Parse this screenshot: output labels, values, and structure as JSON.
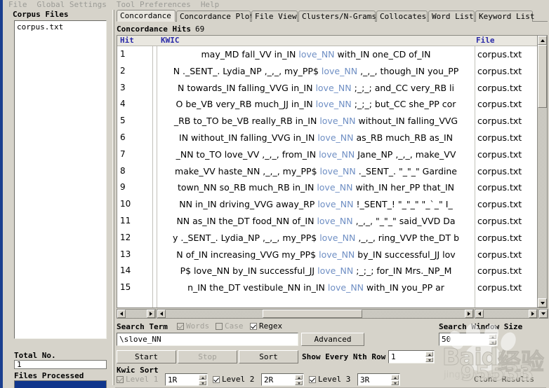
{
  "menu": {
    "items": [
      {
        "label": "File"
      },
      {
        "label": "Global Settings"
      },
      {
        "label": "Tool Preferences"
      },
      {
        "label": "Help"
      }
    ]
  },
  "sidebar": {
    "title": "Corpus Files",
    "files": [
      "corpus.txt"
    ],
    "total_label": "Total No.",
    "total_value": "1",
    "files_processed_label": "Files Processed"
  },
  "tabs": [
    {
      "label": "Concordance",
      "active": true
    },
    {
      "label": "Concordance Plot",
      "active": false
    },
    {
      "label": "File View",
      "active": false
    },
    {
      "label": "Clusters/N-Grams",
      "active": false
    },
    {
      "label": "Collocates",
      "active": false
    },
    {
      "label": "Word List",
      "active": false
    },
    {
      "label": "Keyword List",
      "active": false
    }
  ],
  "results": {
    "hits_label": "Concordance Hits",
    "hits_count": "69",
    "columns": {
      "hit": "Hit",
      "kwic": "KWIC",
      "file": "File"
    },
    "keyword": "love_NN",
    "rows": [
      {
        "n": "1",
        "left": "may_MD fall_VV in_IN",
        "right": "with_IN one_CD of_IN",
        "file": "corpus.txt"
      },
      {
        "n": "2",
        "left": "N ._SENT_. Lydia_NP ,_,_, my_PP$",
        "right": ",_,_, though_IN you_PP",
        "file": "corpus.txt"
      },
      {
        "n": "3",
        "left": "N towards_IN falling_VVG in_IN",
        "right": ";_;_; and_CC very_RB li",
        "file": "corpus.txt"
      },
      {
        "n": "4",
        "left": "O be_VB very_RB much_JJ in_IN",
        "right": ";_;_; but_CC she_PP cor",
        "file": "corpus.txt"
      },
      {
        "n": "5",
        "left": "_RB to_TO be_VB really_RB in_IN",
        "right": "without_IN falling_VVG",
        "file": "corpus.txt"
      },
      {
        "n": "6",
        "left": "IN without_IN falling_VVG in_IN",
        "right": "as_RB much_RB as_IN",
        "file": "corpus.txt"
      },
      {
        "n": "7",
        "left": "_NN to_TO love_VV ,_,_, from_IN",
        "right": "Jane_NP ,_,_, make_VV",
        "file": "corpus.txt"
      },
      {
        "n": "8",
        "left": "make_VV haste_NN ,_,_, my_PP$",
        "right": "._SENT_. \"_\"_\" Gardine",
        "file": "corpus.txt"
      },
      {
        "n": "9",
        "left": "town_NN so_RB much_RB in_IN",
        "right": "with_IN her_PP that_IN",
        "file": "corpus.txt"
      },
      {
        "n": "10",
        "left": "NN in_IN driving_VVG away_RP",
        "right": "!_SENT_! \"_\"_\" \"_`_\" I_",
        "file": "corpus.txt"
      },
      {
        "n": "11",
        "left": "NN as_IN the_DT food_NN of_IN",
        "right": ",_,_, \"_\"_\" said_VVD Da",
        "file": "corpus.txt"
      },
      {
        "n": "12",
        "left": "y ._SENT_. Lydia_NP ,_,_, my_PP$",
        "right": ",_,_, ring_VVP the_DT b",
        "file": "corpus.txt"
      },
      {
        "n": "13",
        "left": "N of_IN increasing_VVG my_PP$",
        "right": "by_IN successful_JJ lov",
        "file": "corpus.txt"
      },
      {
        "n": "14",
        "left": "P$ love_NN by_IN successful_JJ",
        "right": ";_;_; for_IN Mrs._NP_M",
        "file": "corpus.txt"
      },
      {
        "n": "15",
        "left": "n_IN the_DT vestibule_NN in_IN",
        "right": "with_IN you_PP      ar",
        "file": "corpus.txt"
      }
    ]
  },
  "controls": {
    "search_term_label": "Search Term",
    "checkbox_words": "Words",
    "checkbox_case": "Case",
    "checkbox_regex": "Regex",
    "words_checked": true,
    "words_disabled": true,
    "case_checked": false,
    "regex_checked": true,
    "search_value": "\\slove_NN",
    "search_placeholder": "",
    "advanced_label": "Advanced",
    "search_window_label": "Search Window Size",
    "search_window_value": "50",
    "start_label": "Start",
    "stop_label": "Stop",
    "sort_label": "Sort",
    "nth_row_label": "Show Every Nth Row",
    "nth_row_value": "1",
    "kwic_sort_label": "Kwic Sort",
    "level1_label": "Level 1",
    "level1_value": "1R",
    "level1_checked": true,
    "level1_disabled": true,
    "level2_label": "Level 2",
    "level2_value": "2R",
    "level2_checked": true,
    "level3_label": "Level 3",
    "level3_value": "3R",
    "level3_checked": true,
    "clone_results_label": "Clone Results"
  },
  "watermark": {
    "brand": "Baidu",
    "brand_cn": "经验",
    "sub": "jingyan.baidu.com",
    "code": "95533"
  },
  "colors": {
    "face": "#d6d3ca",
    "keyword": "#6f8fc4",
    "header_text": "#2a2aa8",
    "progress": "#10368c",
    "window_edge": "#1b3f8f"
  }
}
